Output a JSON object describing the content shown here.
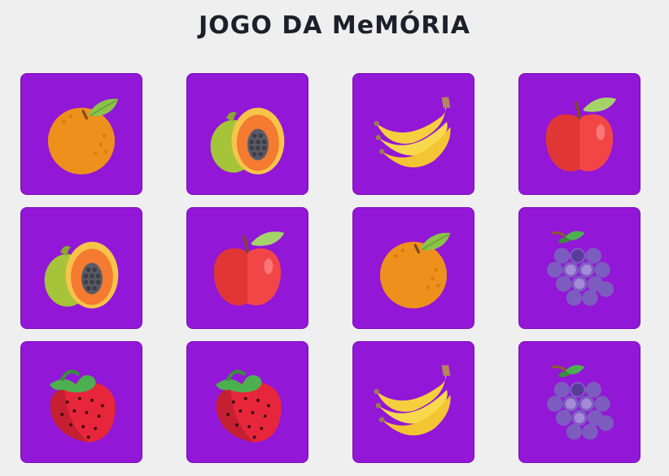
{
  "game": {
    "title": "JOGO DA MeMÓRIA",
    "card_color": "#9217d6",
    "cards": [
      {
        "fruit": "orange"
      },
      {
        "fruit": "papaya"
      },
      {
        "fruit": "banana"
      },
      {
        "fruit": "apple"
      },
      {
        "fruit": "papaya"
      },
      {
        "fruit": "apple"
      },
      {
        "fruit": "orange"
      },
      {
        "fruit": "grapes"
      },
      {
        "fruit": "strawberry"
      },
      {
        "fruit": "strawberry"
      },
      {
        "fruit": "banana"
      },
      {
        "fruit": "grapes"
      }
    ]
  }
}
